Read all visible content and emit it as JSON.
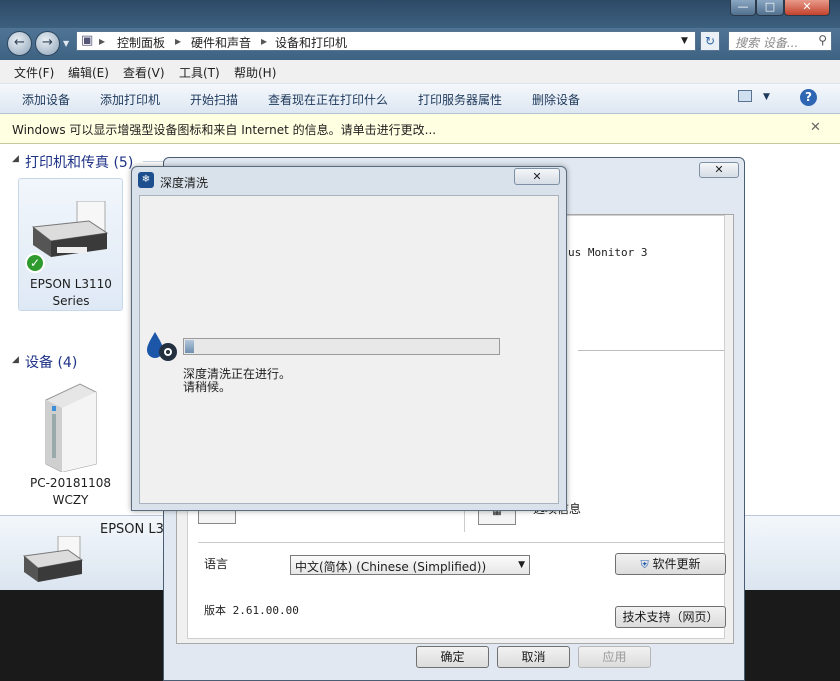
{
  "breadcrumb": [
    "控制面板",
    "硬件和声音",
    "设备和打印机"
  ],
  "search_placeholder": "搜索 设备...",
  "menu": [
    "文件(F)",
    "编辑(E)",
    "查看(V)",
    "工具(T)",
    "帮助(H)"
  ],
  "commands": [
    "添加设备",
    "添加打印机",
    "开始扫描",
    "查看现在正在打印什么",
    "打印服务器属性",
    "删除设备"
  ],
  "infobar_text": "Windows 可以显示增强型设备图标和来自 Internet 的信息。请单击进行更改...",
  "groups": {
    "printers": "打印机和传真 (5)",
    "devices": "设备 (4)"
  },
  "printer_name": "EPSON L3110 Series",
  "device_name": "PC-20181108WCZY",
  "details_name": "EPSON L3",
  "props": {
    "status_monitor_text": "us Monitor 3",
    "info_label": "选项信息",
    "language_label": "语言",
    "language_value": "中文(简体) (Chinese (Simplified))",
    "update_button": "软件更新",
    "version_text": "版本 2.61.00.00",
    "support_button": "技术支持（网页）",
    "ok_button": "确定",
    "cancel_button": "取消",
    "apply_button": "应用"
  },
  "dialog": {
    "title": "深度清洗",
    "status_line1": "深度清洗正在进行。",
    "status_line2": "请稍候。",
    "progress": 0.03
  },
  "colors": {
    "accent": "#1e3287",
    "infobar": "#ffffe1",
    "title": "#3d607f"
  }
}
